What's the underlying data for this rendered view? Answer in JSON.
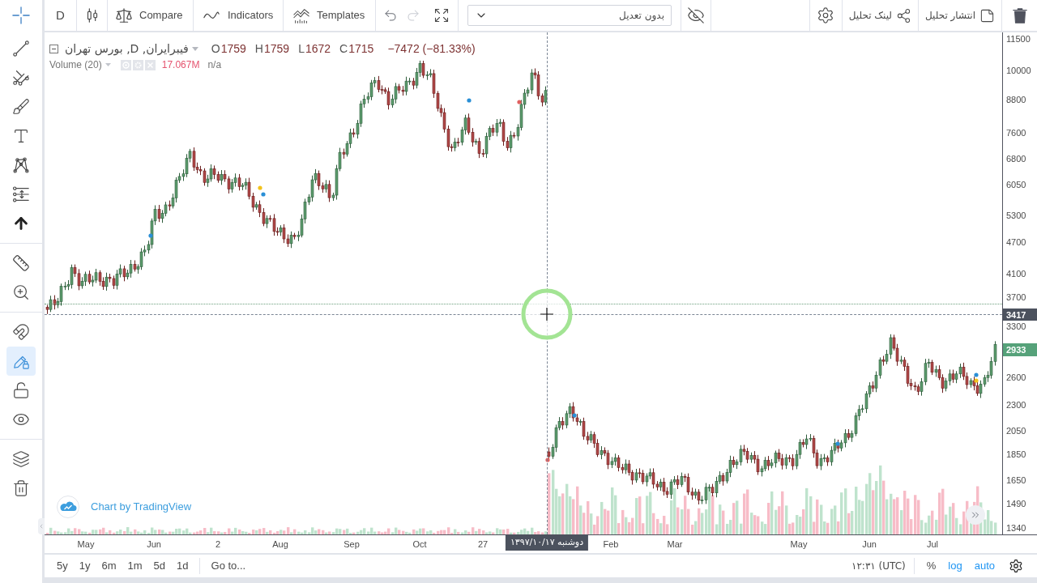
{
  "drawing_toolbar": {
    "tools": [
      {
        "selected": true
      },
      {
        "selected": false
      },
      {
        "selected": false
      },
      {
        "selected": false
      },
      {
        "selected": false
      },
      {
        "selected": false
      },
      {
        "selected": false
      },
      {
        "selected": false
      },
      {
        "selected": false
      },
      {
        "selected": false
      }
    ],
    "toggles": [
      {
        "on": false
      },
      {
        "on": true
      },
      {
        "on": false
      },
      {
        "on": false
      }
    ]
  },
  "top_toolbar": {
    "interval": "D",
    "compare": "Compare",
    "indicators": "Indicators",
    "templates": "Templates",
    "undo": {
      "disabled": false
    },
    "redo": {
      "disabled": true
    },
    "adjustment_select": {
      "value": "بدون تعدیل"
    },
    "share_link": "لینک تحلیل",
    "publish": "انتشار تحلیل"
  },
  "legend": {
    "title": "فیبرایران, D, بورس تهران",
    "ohlc": [
      {
        "label": "O",
        "value": "1759"
      },
      {
        "label": "H",
        "value": "1759"
      },
      {
        "label": "L",
        "value": "1672"
      },
      {
        "label": "C",
        "value": "1715"
      }
    ],
    "change": "−7472 (−81.33%)",
    "volume": {
      "title": "Volume (20)",
      "value": "17.067M",
      "secondary": "n/a"
    }
  },
  "chart": {
    "attribution": "Chart by TradingView"
  },
  "price_axis": {
    "labels": [
      "11500",
      "10000",
      "8800",
      "7600",
      "6800",
      "6050",
      "5300",
      "4700",
      "4100",
      "3700",
      "3300",
      "2600",
      "2300",
      "2050",
      "1850",
      "1650",
      "1490",
      "1340"
    ],
    "crosshair_label": "3417",
    "last_price_label": "2933"
  },
  "time_axis": {
    "labels": [
      "May",
      "Jun",
      "2",
      "Aug",
      "Sep",
      "Oct",
      "27",
      "Feb",
      "Mar",
      "May",
      "Jun",
      "Jul"
    ],
    "crosshair_label": "دوشنبه ۱۳۹۷/۱۰/۱۷"
  },
  "bottom_toolbar": {
    "ranges": [
      "5y",
      "1y",
      "6m",
      "1m",
      "5d",
      "1d"
    ],
    "goto": "Go to...",
    "clock": "۱۲:۳۱ (UTC)",
    "scale_buttons": [
      {
        "label": "%",
        "on": false
      },
      {
        "label": "log",
        "on": true
      },
      {
        "label": "auto",
        "on": true
      }
    ]
  }
}
